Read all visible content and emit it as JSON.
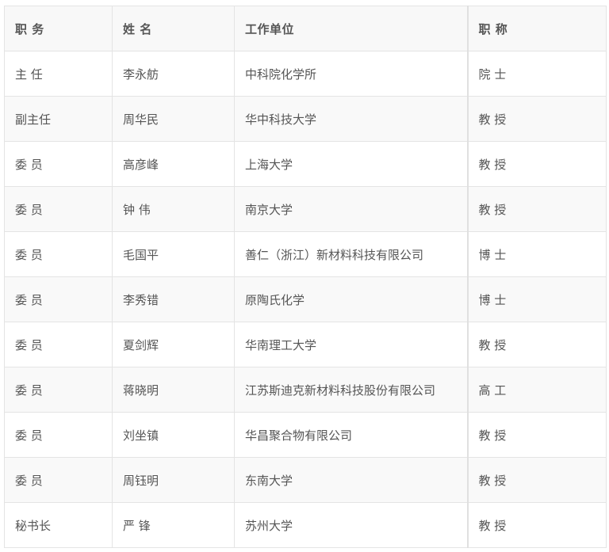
{
  "headers": [
    "职 务",
    "姓 名",
    "工作单位",
    "职 称"
  ],
  "rows": [
    [
      "主 任",
      "李永舫",
      "中科院化学所",
      "院 士"
    ],
    [
      "副主任",
      "周华民",
      "华中科技大学",
      "教 授"
    ],
    [
      "委 员",
      "高彦峰",
      "上海大学",
      "教 授"
    ],
    [
      "委 员",
      "钟 伟",
      "南京大学",
      "教 授"
    ],
    [
      "委 员",
      "毛国平",
      "善仁（浙江）新材料科技有限公司",
      "博 士"
    ],
    [
      "委 员",
      "李秀错",
      "原陶氏化学",
      "博 士"
    ],
    [
      "委 员",
      "夏剑辉",
      "华南理工大学",
      "教 授"
    ],
    [
      "委 员",
      "蒋晓明",
      "江苏斯迪克新材料科技股份有限公司",
      "高 工"
    ],
    [
      "委 员",
      "刘坐镇",
      "华昌聚合物有限公司",
      "教 授"
    ],
    [
      "委 员",
      "周钰明",
      "东南大学",
      "教 授"
    ],
    [
      "秘书长",
      "严 锋",
      "苏州大学",
      "教 授"
    ]
  ]
}
